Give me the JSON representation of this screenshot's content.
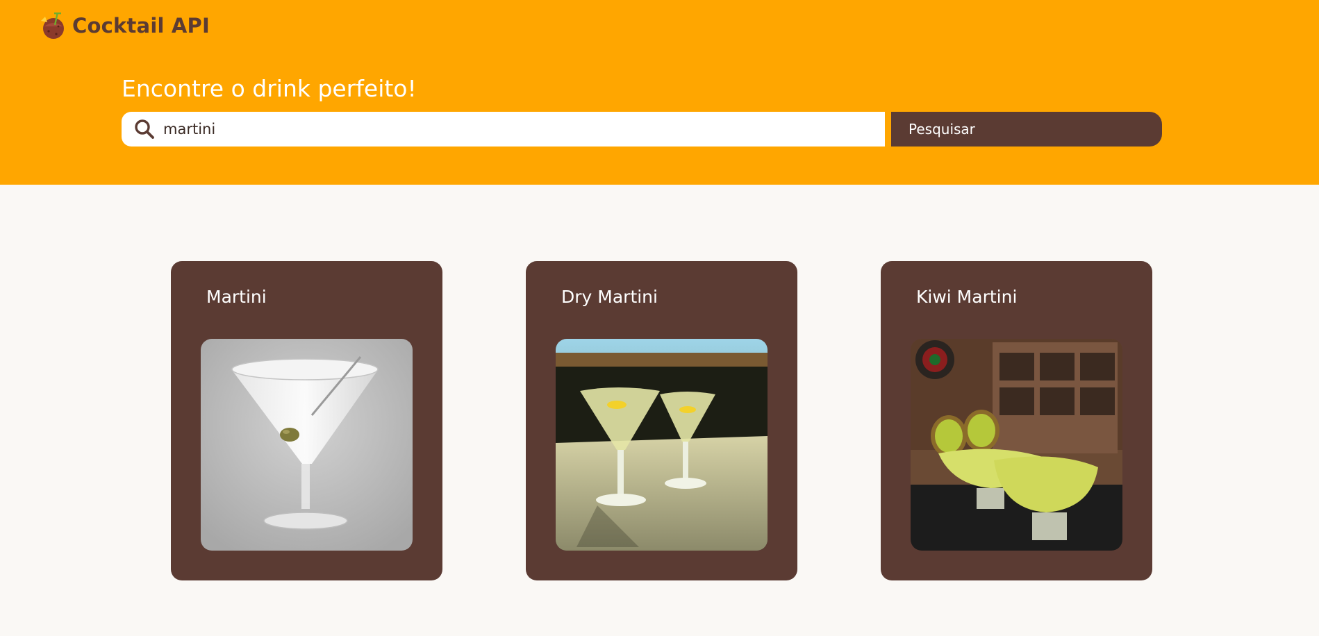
{
  "app": {
    "name": "Cocktail API",
    "logo_icon": "coconut-drink-icon"
  },
  "hero": {
    "title": "Encontre o drink perfeito!"
  },
  "search": {
    "icon": "search-icon",
    "value": "martini",
    "button_label": "Pesquisar"
  },
  "results": [
    {
      "name": "Martini",
      "image": "martini-photo"
    },
    {
      "name": "Dry Martini",
      "image": "dry-martini-photo"
    },
    {
      "name": "Kiwi Martini",
      "image": "kiwi-martini-photo"
    }
  ],
  "colors": {
    "header": "#ffa600",
    "accent": "#5b3b33",
    "background": "#faf8f5",
    "card_title": "#ffffff"
  }
}
